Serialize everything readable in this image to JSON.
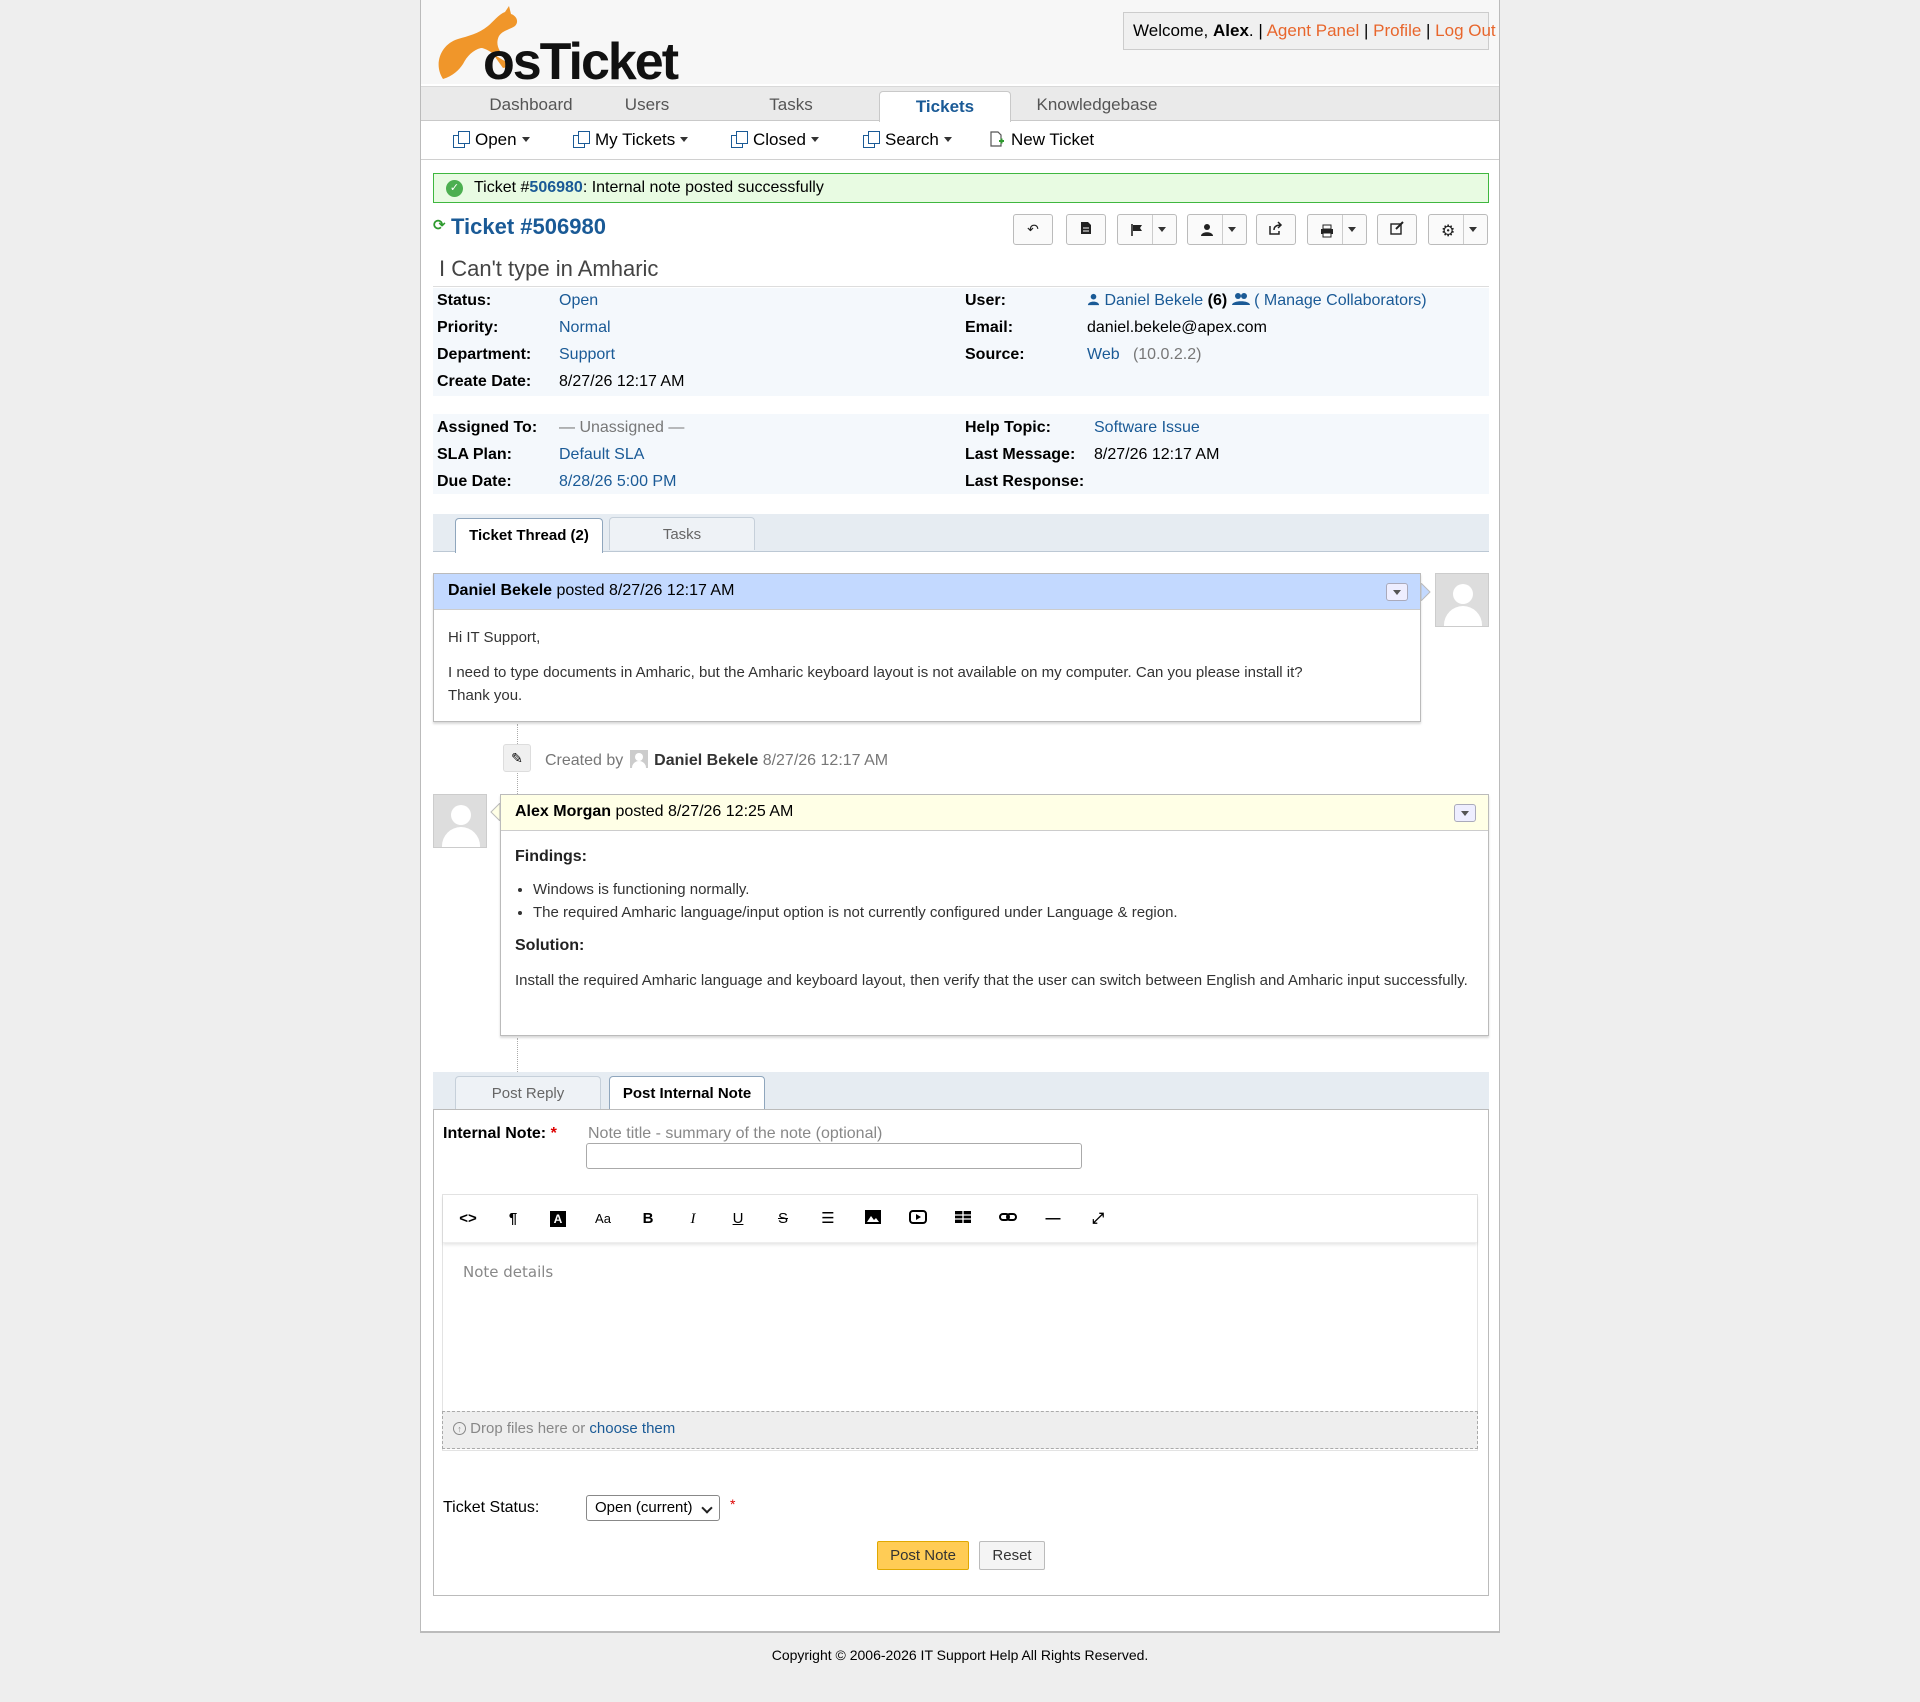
{
  "header": {
    "logo_text": "osTicket",
    "welcome_prefix": "Welcome, ",
    "user_name": "Alex",
    "welcome_suffix": ". |",
    "links": [
      "Agent Panel",
      "Profile",
      "Log Out"
    ]
  },
  "nav": {
    "tabs": [
      {
        "label": "Dashboard",
        "active": false
      },
      {
        "label": "Users",
        "active": false
      },
      {
        "label": "Tasks",
        "active": false
      },
      {
        "label": "Tickets",
        "active": true
      },
      {
        "label": "Knowledgebase",
        "active": false
      }
    ]
  },
  "subnav": {
    "items": [
      "Open",
      "My Tickets",
      "Closed",
      "Search",
      "New Ticket"
    ]
  },
  "notice": {
    "prefix": "Ticket #",
    "ticket_number": "506980",
    "message": ": Internal note posted successfully"
  },
  "ticket": {
    "title": "Ticket #506980",
    "subject": "I Can't type in Amharic",
    "status_label": "Status:",
    "status": "Open",
    "priority_label": "Priority:",
    "priority": "Normal",
    "department_label": "Department:",
    "department": "Support",
    "create_date_label": "Create Date:",
    "create_date": "8/27/26 12:17 AM",
    "user_label": "User:",
    "user_name": "Daniel Bekele",
    "user_count": "(6)",
    "manage_collaborators": "( Manage Collaborators)",
    "email_label": "Email:",
    "email": "daniel.bekele@apex.com",
    "source_label": "Source:",
    "source": "Web",
    "source_ip": "(10.0.2.2)",
    "assigned_label": "Assigned To:",
    "assigned": "— Unassigned —",
    "sla_label": "SLA Plan:",
    "sla": "Default SLA",
    "due_label": "Due Date:",
    "due": "8/28/26 5:00 PM",
    "help_topic_label": "Help Topic:",
    "help_topic": "Software Issue",
    "last_message_label": "Last Message:",
    "last_message": "8/27/26 12:17 AM",
    "last_response_label": "Last Response:",
    "last_response": ""
  },
  "thread_tabs": [
    "Ticket Thread (2)",
    "Tasks"
  ],
  "thread": {
    "message": {
      "author": "Daniel Bekele",
      "posted": " posted 8/27/26 12:17 AM",
      "greeting": "Hi IT Support,",
      "body": "I need to type documents in Amharic, but the Amharic keyboard layout is not available on my computer. Can you please install it?",
      "closing": "Thank you."
    },
    "event": {
      "prefix": "Created by",
      "author": "Daniel Bekele",
      "time": "8/27/26 12:17 AM"
    },
    "note": {
      "author": "Alex Morgan",
      "posted": " posted 8/27/26 12:25 AM",
      "findings_heading": "Findings:",
      "findings": [
        "Windows is functioning normally.",
        "The required Amharic language/input option is not currently configured under Language & region."
      ],
      "solution_heading": "Solution:",
      "solution": "Install the required Amharic language and keyboard layout, then verify that the user can switch between English and Amharic input successfully."
    }
  },
  "reply_tabs": [
    "Post Reply",
    "Post Internal Note"
  ],
  "form": {
    "note_label": "Internal Note:",
    "required_mark": "*",
    "title_placeholder": "Note title - summary of the note (optional)",
    "editor_placeholder": "Note details",
    "drop_text": "Drop files here or ",
    "drop_link": "choose them",
    "status_label": "Ticket Status:",
    "status_value": "Open (current)",
    "post_button": "Post Note",
    "reset_button": "Reset"
  },
  "footer": {
    "copyright": "Copyright © 2006-2026 IT Support Help All Rights Reserved."
  },
  "colors": {
    "link": "#1a5a96",
    "orange": "#e8662c",
    "message_header": "#c3d9ff",
    "note_header": "#ffffe6",
    "success_border": "#3fb73f",
    "post_button": "#ffcc55"
  },
  "icons": [
    "kangaroo-logo-icon",
    "check-circle-icon",
    "refresh-icon",
    "copy-icon",
    "new-ticket-icon",
    "reply-icon",
    "file-icon",
    "flag-icon",
    "user-icon",
    "share-icon",
    "print-icon",
    "edit-icon",
    "gear-icon",
    "users-icon",
    "wand-icon",
    "chevron-down-icon"
  ]
}
